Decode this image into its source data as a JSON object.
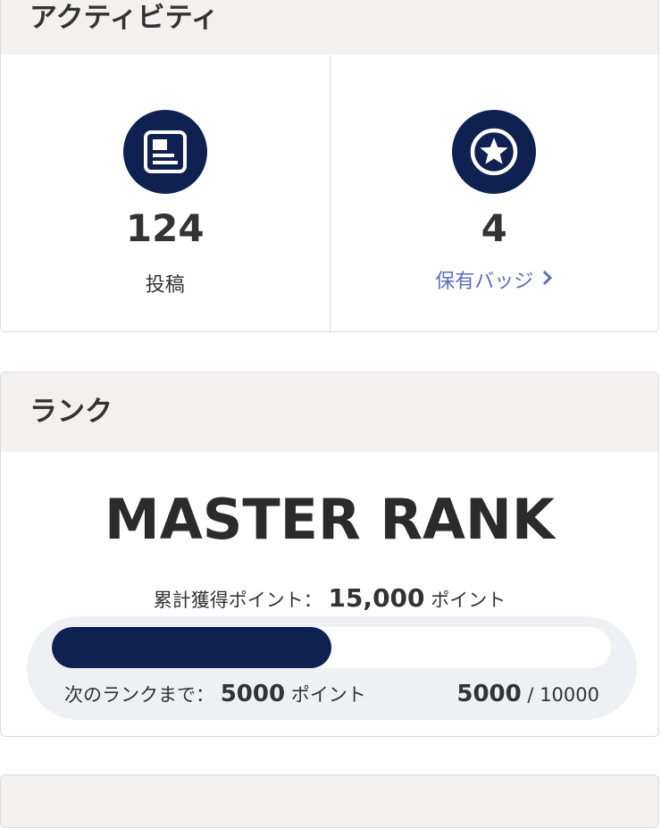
{
  "activity": {
    "title": "アクティビティ",
    "posts": {
      "value": "124",
      "label": "投稿",
      "icon": "document-icon"
    },
    "badges": {
      "value": "4",
      "label": "保有バッジ",
      "icon": "star-badge-icon"
    }
  },
  "rank": {
    "title": "ランク",
    "rank_name": "MASTER RANK",
    "total_prefix": "累計獲得ポイント：",
    "total_value": "15,000",
    "total_suffix": "ポイント",
    "next_prefix": "次のランクまで：",
    "next_value": "5000",
    "next_suffix": "ポイント",
    "current": "5000",
    "separator": "/",
    "target": "10000",
    "progress_fraction": 0.5
  },
  "colors": {
    "navy": "#0f2150",
    "link": "#5a6fb5",
    "header_bg": "#f2f1f0"
  }
}
